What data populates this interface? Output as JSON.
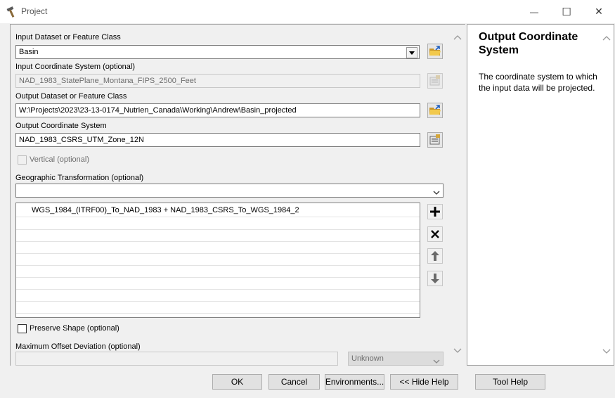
{
  "window": {
    "title": "Project",
    "minimize_glyph": "—",
    "maximize_glyph": "☐",
    "close_glyph": "✕"
  },
  "form": {
    "input_dataset_label": "Input Dataset or Feature Class",
    "input_dataset_value": "Basin",
    "input_cs_label": "Input Coordinate System (optional)",
    "input_cs_value": "NAD_1983_StatePlane_Montana_FIPS_2500_Feet",
    "output_dataset_label": "Output Dataset or Feature Class",
    "output_dataset_value": "W:\\Projects\\2023\\23-13-0174_Nutrien_Canada\\Working\\Andrew\\Basin_projected",
    "output_cs_label": "Output Coordinate System",
    "output_cs_value": "NAD_1983_CSRS_UTM_Zone_12N",
    "vertical_label": "Vertical (optional)",
    "geo_transform_label": "Geographic Transformation (optional)",
    "geo_transform_value": "",
    "transform_list": [
      "WGS_1984_(ITRF00)_To_NAD_1983 + NAD_1983_CSRS_To_WGS_1984_2"
    ],
    "preserve_shape_label": "Preserve Shape (optional)",
    "max_offset_label": "Maximum Offset Deviation (optional)",
    "max_offset_value": "",
    "unit_value": "Unknown"
  },
  "help": {
    "title": "Output Coordinate System",
    "body": "The coordinate system to which the input data will be projected."
  },
  "buttons": {
    "ok": "OK",
    "cancel": "Cancel",
    "environments": "Environments...",
    "hide_help": "<< Hide Help",
    "tool_help": "Tool Help"
  },
  "colors": {
    "folder_yellow": "#f2c94c",
    "folder_dark": "#c9962a",
    "arrow_blue": "#1f5fbf"
  }
}
